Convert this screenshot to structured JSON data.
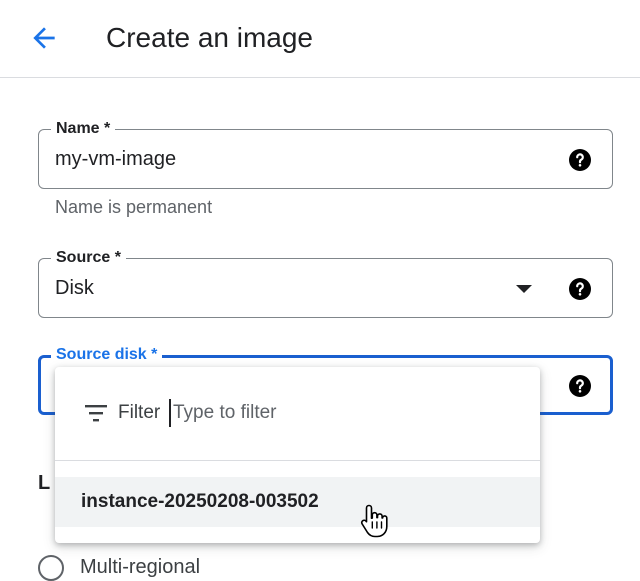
{
  "header": {
    "title": "Create an image"
  },
  "form": {
    "name": {
      "label": "Name *",
      "value": "my-vm-image",
      "hint": "Name is permanent"
    },
    "source": {
      "label": "Source *",
      "value": "Disk"
    },
    "source_disk": {
      "label": "Source disk *"
    },
    "location_partial": "L",
    "location_option_partial": "Multi-regional"
  },
  "dropdown": {
    "filter_label": "Filter",
    "filter_placeholder": "Type to filter",
    "items": [
      {
        "label": "instance-20250208-003502"
      }
    ]
  },
  "colors": {
    "accent": "#1a73e8",
    "focus_border": "#1a5fcf"
  }
}
